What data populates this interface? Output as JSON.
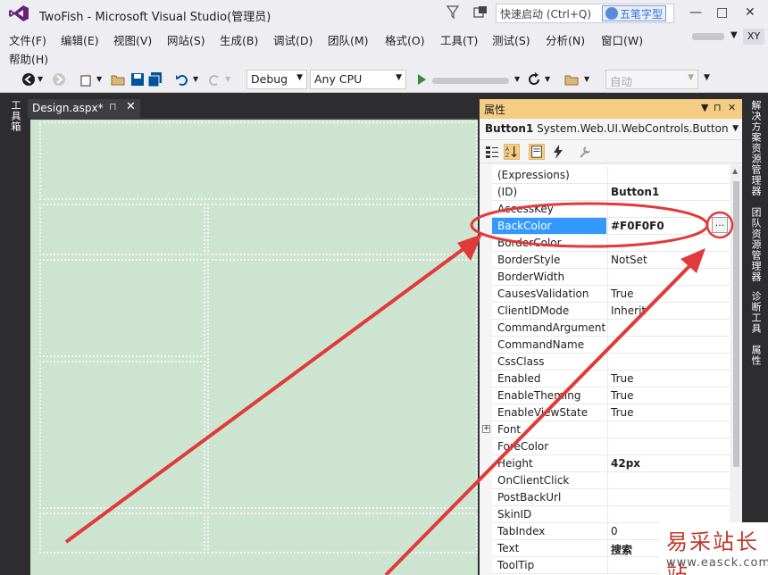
{
  "titlebar": {
    "title": "TwoFish - Microsoft Visual Studio(管理员)",
    "quicklaunch_placeholder": "快速启动 (Ctrl+Q)",
    "ime_label": "五笔字型",
    "minimize": "—",
    "close": "✕"
  },
  "menu": {
    "items": [
      "文件(F)",
      "编辑(E)",
      "视图(V)",
      "网站(S)",
      "生成(B)",
      "调试(D)",
      "团队(M)",
      "格式(O)",
      "工具(T)",
      "测试(S)",
      "分析(N)",
      "窗口(W)",
      "帮助(H)"
    ],
    "avatar": "XY"
  },
  "toolbar": {
    "config": "Debug",
    "platform": "Any CPU",
    "auto": "自动"
  },
  "left_tabs": [
    "工具箱"
  ],
  "right_tabs": [
    "解决方案资源管理器",
    "团队资源管理器",
    "诊断工具",
    "属性"
  ],
  "document_tab": {
    "label": "Design.aspx*",
    "pin": "⊓",
    "close": "✕"
  },
  "properties": {
    "title": "属性",
    "object_name": "Button1",
    "object_type": "System.Web.UI.WebControls.Button",
    "ellipsis": "...",
    "rows": [
      {
        "name": "(Expressions)",
        "value": ""
      },
      {
        "name": "(ID)",
        "value": "Button1"
      },
      {
        "name": "AccessKey",
        "value": ""
      },
      {
        "name": "BackColor",
        "value": "#F0F0F0"
      },
      {
        "name": "BorderColor",
        "value": ""
      },
      {
        "name": "BorderStyle",
        "value": "NotSet"
      },
      {
        "name": "BorderWidth",
        "value": ""
      },
      {
        "name": "CausesValidation",
        "value": "True"
      },
      {
        "name": "ClientIDMode",
        "value": "Inherit"
      },
      {
        "name": "CommandArgument",
        "value": ""
      },
      {
        "name": "CommandName",
        "value": ""
      },
      {
        "name": "CssClass",
        "value": ""
      },
      {
        "name": "Enabled",
        "value": "True"
      },
      {
        "name": "EnableTheming",
        "value": "True"
      },
      {
        "name": "EnableViewState",
        "value": "True"
      },
      {
        "name": "Font",
        "value": ""
      },
      {
        "name": "ForeColor",
        "value": ""
      },
      {
        "name": "Height",
        "value": "42px"
      },
      {
        "name": "OnClientClick",
        "value": ""
      },
      {
        "name": "PostBackUrl",
        "value": ""
      },
      {
        "name": "SkinID",
        "value": ""
      },
      {
        "name": "TabIndex",
        "value": "0"
      },
      {
        "name": "Text",
        "value": "搜索"
      },
      {
        "name": "ToolTip",
        "value": ""
      }
    ]
  },
  "watermark": {
    "title": "易采站长站",
    "url": "www.easck.com"
  },
  "colors": {
    "accent": "#f5cc84",
    "selection": "#3399ff",
    "designer_bg": "#cde5d0",
    "annotation": "#e03a3a"
  }
}
